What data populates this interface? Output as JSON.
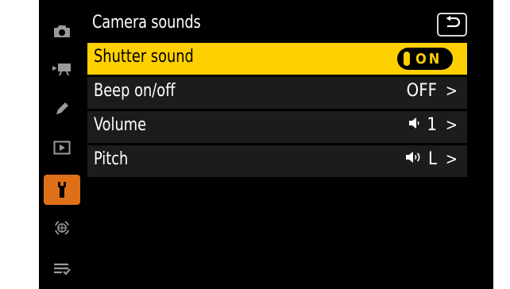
{
  "sidebar": {
    "tabs": [
      {
        "icon": "camera-icon",
        "active": false
      },
      {
        "icon": "movie-camera-icon",
        "active": false
      },
      {
        "icon": "pencil-icon",
        "active": false
      },
      {
        "icon": "playback-icon",
        "active": false
      },
      {
        "icon": "wrench-icon",
        "active": true
      },
      {
        "icon": "network-icon",
        "active": false
      },
      {
        "icon": "my-menu-icon",
        "active": false
      }
    ]
  },
  "header": {
    "title": "Camera sounds",
    "back_icon": "return-arrow-icon"
  },
  "menu": {
    "items": [
      {
        "label": "Shutter sound",
        "value": "ON",
        "selected": true
      },
      {
        "label": "Beep on/off",
        "value": "OFF",
        "selected": false
      },
      {
        "label": "Volume",
        "value": "1",
        "value_icon": "speaker-low-icon",
        "selected": false
      },
      {
        "label": "Pitch",
        "value": "L",
        "value_icon": "speaker-high-icon",
        "selected": false
      }
    ],
    "chevron": ">"
  },
  "colors": {
    "highlight": "#ffd000",
    "active_tab": "#e07018",
    "row_bg": "#1c1c1c",
    "background": "#000000"
  }
}
